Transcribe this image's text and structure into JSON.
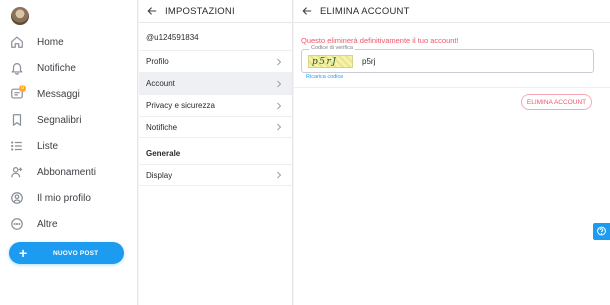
{
  "sidebar": {
    "items": [
      {
        "label": "Home",
        "icon": "home-icon"
      },
      {
        "label": "Notifiche",
        "icon": "bell-icon"
      },
      {
        "label": "Messaggi",
        "icon": "message-icon",
        "badge": "0"
      },
      {
        "label": "Segnalibri",
        "icon": "bookmark-icon"
      },
      {
        "label": "Liste",
        "icon": "list-icon"
      },
      {
        "label": "Abbonamenti",
        "icon": "subscriptions-icon"
      },
      {
        "label": "Il mio profilo",
        "icon": "profile-icon"
      },
      {
        "label": "Altre",
        "icon": "more-icon"
      }
    ],
    "new_post_label": "NUOVO POST"
  },
  "settings": {
    "title": "IMPOSTAZIONI",
    "username": "@u124591834",
    "items": [
      {
        "label": "Profilo"
      },
      {
        "label": "Account",
        "active": true
      },
      {
        "label": "Privacy e sicurezza"
      },
      {
        "label": "Notifiche"
      }
    ],
    "section_general": "Generale",
    "display_label": "Display"
  },
  "panel": {
    "title": "ELIMINA ACCOUNT",
    "warning": "Questo eliminerà definitivamente il tuo account!",
    "captcha_caption": "Codice di verifica",
    "captcha_image_text": "p5rJ",
    "captcha_value": "p5rj",
    "reload_label": "Ricarica codice",
    "delete_label": "ELIMINA ACCOUNT"
  },
  "colors": {
    "accent": "#1d9bf0",
    "danger": "#f3556a",
    "badge": "#ffa726"
  }
}
